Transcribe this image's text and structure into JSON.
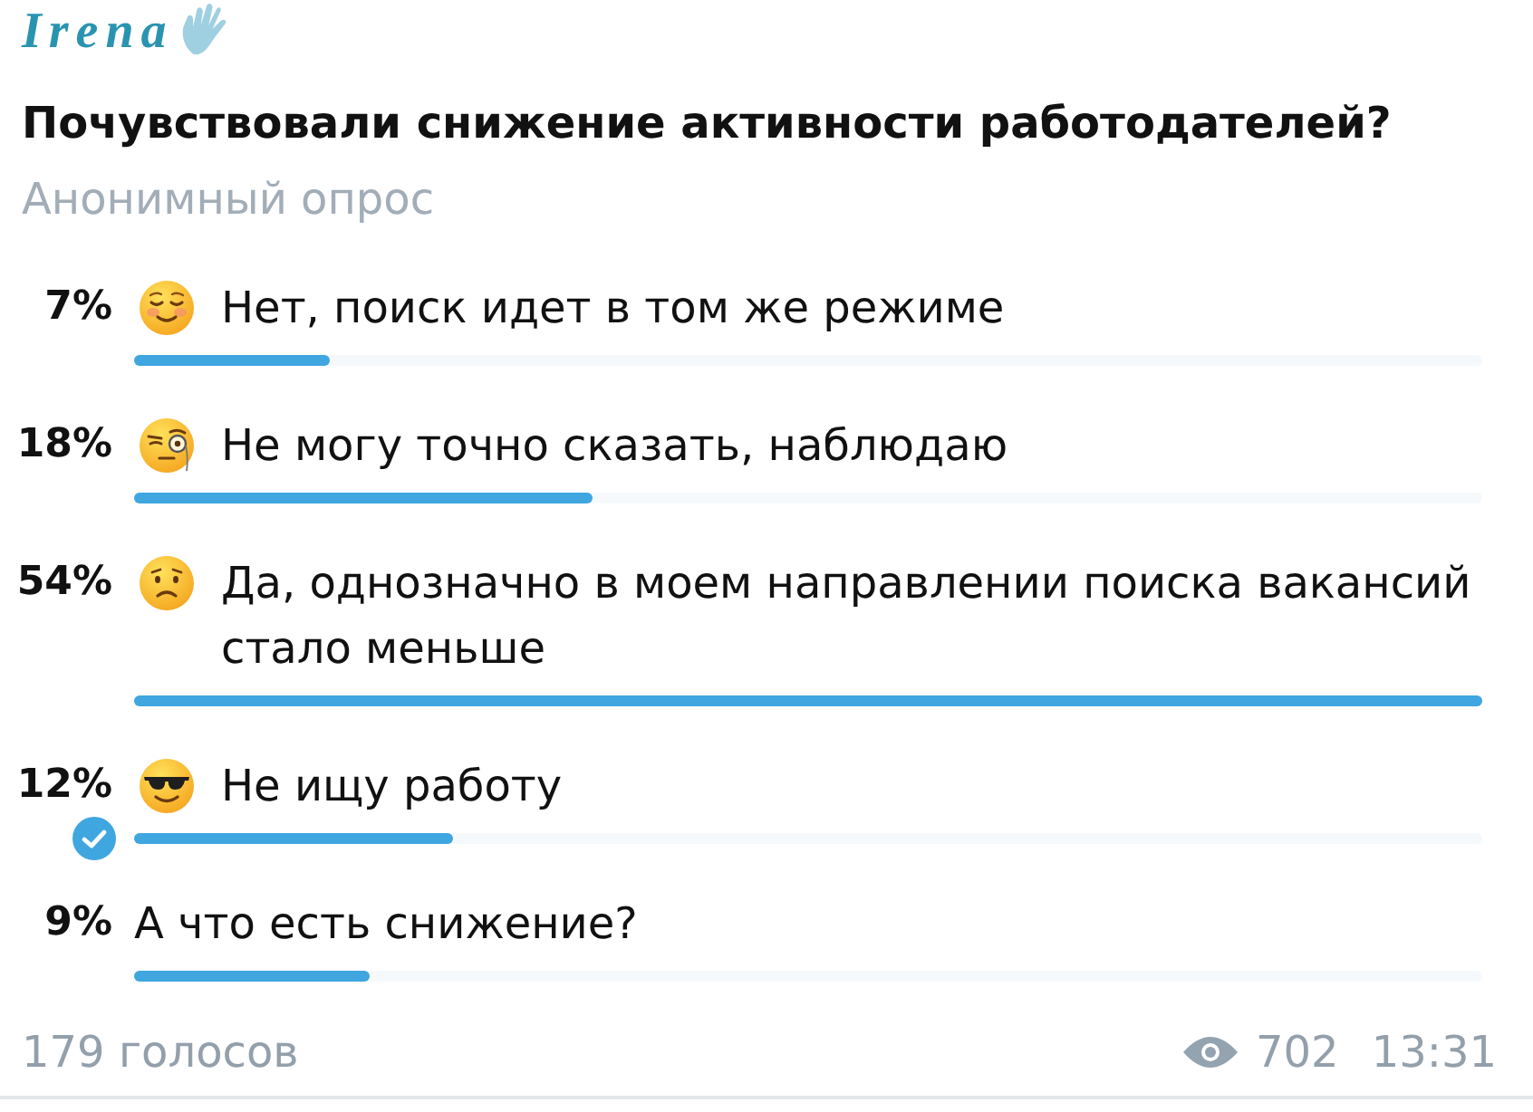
{
  "author": {
    "name": "Irena"
  },
  "question": "Почувствовали снижение активности работодателей?",
  "poll_type": "Анонимный опрос",
  "options": [
    {
      "percent": "7%",
      "kind": "blush",
      "text": "Нет, поиск идет в том же режиме",
      "level": 0.145,
      "selected": false
    },
    {
      "percent": "18%",
      "kind": "monocle",
      "text": "Не могу точно сказать, наблюдаю",
      "level": 0.34,
      "selected": false
    },
    {
      "percent": "54%",
      "kind": "frown",
      "text": "Да, однозначно в моем направлении поиска вакансий стало меньше",
      "level": 1.0,
      "selected": false
    },
    {
      "percent": "12%",
      "kind": "sunglasses",
      "text": "Не ищу работу",
      "level": 0.237,
      "selected": true
    },
    {
      "percent": "9%",
      "kind": "plain",
      "text": "А что есть снижение?",
      "level": 0.175,
      "selected": false
    }
  ],
  "footer": {
    "votes": "179 голосов",
    "views": "702",
    "time": "13:31"
  }
}
